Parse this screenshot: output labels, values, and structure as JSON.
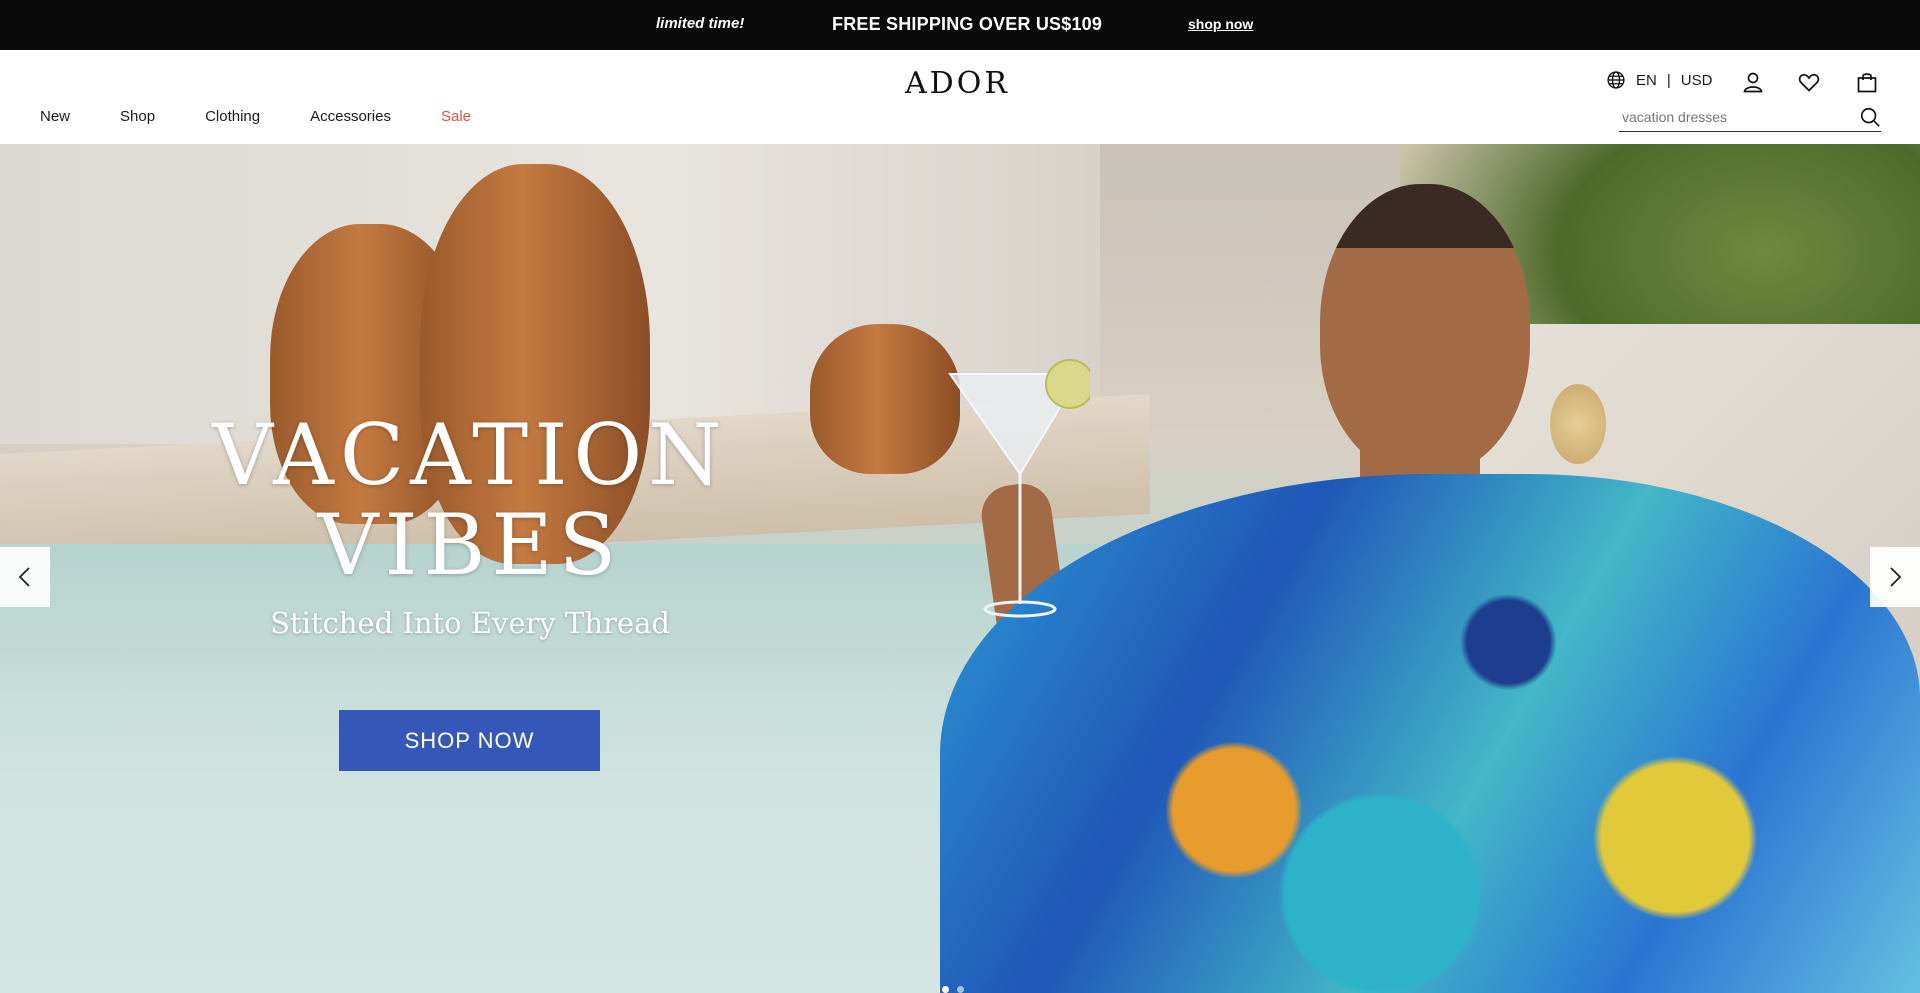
{
  "announcement": {
    "limited": "limited time!",
    "shipping": "FREE SHIPPING OVER US$109",
    "link": "shop now"
  },
  "header": {
    "logo": "ADOR",
    "nav": [
      {
        "label": "New"
      },
      {
        "label": "Shop"
      },
      {
        "label": "Clothing"
      },
      {
        "label": "Accessories"
      },
      {
        "label": "Sale"
      }
    ],
    "language": "EN",
    "separator": "|",
    "currency": "USD",
    "search_placeholder": "vacation dresses"
  },
  "hero": {
    "title_line1": "VACATION",
    "title_line2": "VIBES",
    "subtitle": "Stitched Into Every Thread",
    "cta": "SHOP NOW",
    "active_slide": 1
  },
  "colors": {
    "announcement_bg": "#0a0a0a",
    "sale": "#e2534a",
    "cta_bg": "#3558b8"
  }
}
